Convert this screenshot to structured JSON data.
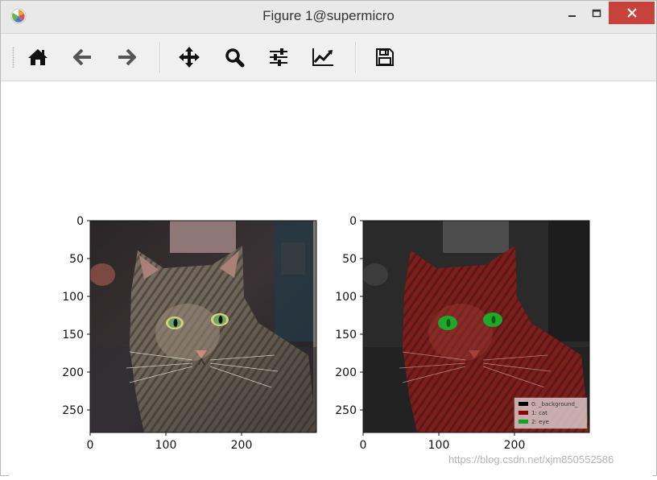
{
  "window": {
    "title": "Figure 1@supermicro",
    "minimize_label": "–",
    "maximize_label": "□",
    "close_label": "✕"
  },
  "toolbar": {
    "items": [
      {
        "name": "home-icon",
        "label": "Home"
      },
      {
        "name": "back-icon",
        "label": "Back"
      },
      {
        "name": "forward-icon",
        "label": "Forward"
      },
      {
        "name": "pan-icon",
        "label": "Pan"
      },
      {
        "name": "zoom-icon",
        "label": "Zoom"
      },
      {
        "name": "subplots-icon",
        "label": "Configure subplots"
      },
      {
        "name": "axes-curves-icon",
        "label": "Edit axis"
      },
      {
        "name": "save-icon",
        "label": "Save"
      }
    ]
  },
  "figure": {
    "subplots": [
      {
        "image": "cat-photo",
        "y_ticks": [
          "0",
          "50",
          "100",
          "150",
          "200",
          "250"
        ],
        "x_ticks": [
          "0",
          "100",
          "200"
        ]
      },
      {
        "image": "cat-segmentation-overlay",
        "y_ticks": [
          "0",
          "50",
          "100",
          "150",
          "200",
          "250"
        ],
        "x_ticks": [
          "0",
          "100",
          "200"
        ],
        "legend": [
          {
            "label": "0: _background_",
            "color": "#000000"
          },
          {
            "label": "1: cat",
            "color": "#8b0000"
          },
          {
            "label": "2: eye",
            "color": "#11a31c"
          }
        ]
      }
    ],
    "watermark": "https://blog.csdn.net/xjm850552586"
  },
  "chart_data": [
    {
      "type": "image",
      "xlim": [
        0,
        300
      ],
      "ylim": [
        280,
        0
      ],
      "x_ticks": [
        0,
        100,
        200
      ],
      "y_ticks": [
        0,
        50,
        100,
        150,
        200,
        250
      ]
    },
    {
      "type": "image",
      "xlim": [
        0,
        300
      ],
      "ylim": [
        280,
        0
      ],
      "x_ticks": [
        0,
        100,
        200
      ],
      "y_ticks": [
        0,
        50,
        100,
        150,
        200,
        250
      ],
      "legend": [
        "0: _background_",
        "1: cat",
        "2: eye"
      ]
    }
  ]
}
